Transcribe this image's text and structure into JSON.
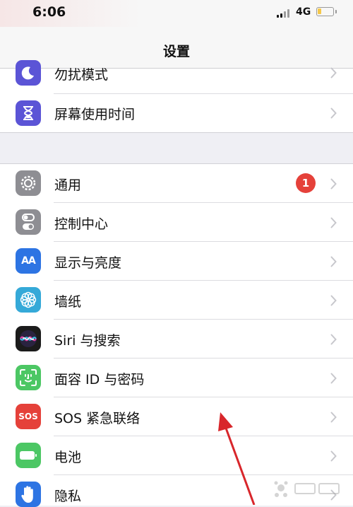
{
  "status_bar": {
    "time": "6:06",
    "network": "4G",
    "battery_level": 0.25
  },
  "nav": {
    "title": "设置"
  },
  "group1": [
    {
      "label": "勿扰模式",
      "icon": "moon-icon",
      "color": "#5b54d6"
    },
    {
      "label": "屏幕使用时间",
      "icon": "hourglass-icon",
      "color": "#5b54d6"
    }
  ],
  "group2": [
    {
      "label": "通用",
      "icon": "gear-icon",
      "color": "#8e8e93",
      "badge": "1"
    },
    {
      "label": "控制中心",
      "icon": "toggle-switches-icon",
      "color": "#8e8e93"
    },
    {
      "label": "显示与亮度",
      "icon": "text-size-icon",
      "color": "#2d74e3"
    },
    {
      "label": "墙纸",
      "icon": "flower-icon",
      "color": "#35a9d8"
    },
    {
      "label": "Siri 与搜索",
      "icon": "siri-icon",
      "color": "#1b1b1b"
    },
    {
      "label": "面容 ID 与密码",
      "icon": "face-id-icon",
      "color": "#4cc764"
    },
    {
      "label": "SOS 紧急联络",
      "icon": "sos-icon",
      "color": "#e5413a"
    },
    {
      "label": "电池",
      "icon": "battery-icon",
      "color": "#4cc764"
    },
    {
      "label": "隐私",
      "icon": "hand-icon",
      "color": "#2d74e3"
    }
  ],
  "icon_text": {
    "text_size": "AA",
    "sos": "SOS"
  },
  "colors": {
    "annotation_arrow": "#d8262b",
    "badge": "#e5413a",
    "chevron": "#c7c7cc"
  }
}
